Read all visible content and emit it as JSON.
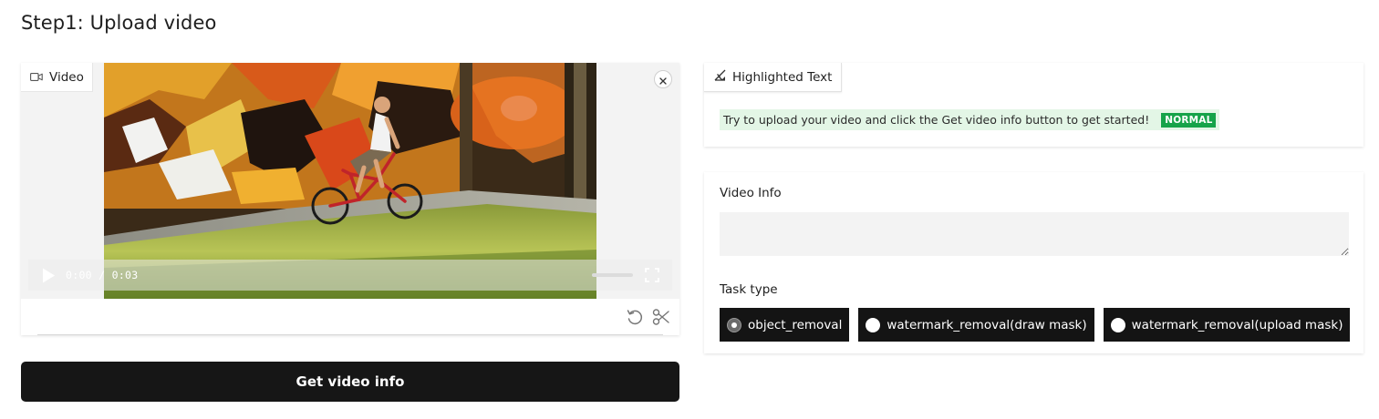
{
  "page": {
    "title": "Step1: Upload video"
  },
  "video": {
    "label": "Video",
    "time_current": "0:00",
    "time_separator": "/",
    "time_total": "0:03",
    "icons": [
      "video-camera-icon",
      "close-icon",
      "play-icon",
      "fullscreen-icon",
      "undo-icon",
      "scissors-icon"
    ]
  },
  "get_info_button": "Get video info",
  "highlight": {
    "label": "Highlighted Text",
    "text": "Try to upload your video and click the Get video info button to get started!",
    "tag": "NORMAL",
    "tag_color": "#16a34a",
    "bg_color": "#e3f6e6"
  },
  "video_info": {
    "label": "Video Info",
    "value": ""
  },
  "task_type": {
    "label": "Task type",
    "options": [
      {
        "label": "object_removal",
        "selected": true
      },
      {
        "label": "watermark_removal(draw mask)",
        "selected": false
      },
      {
        "label": "watermark_removal(upload mask)",
        "selected": false
      }
    ]
  }
}
